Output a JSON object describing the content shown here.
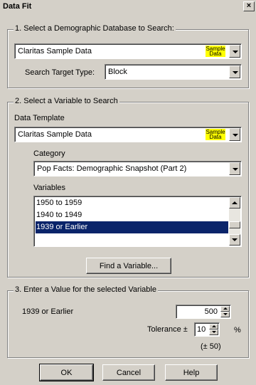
{
  "window": {
    "title": "Data Fit",
    "close_glyph": "×"
  },
  "section1": {
    "title": "1. Select a Demographic Database to Search:",
    "database": {
      "value": "Claritas Sample Data",
      "badge_line1": "Sample",
      "badge_line2": "Data"
    },
    "target_type_label": "Search Target Type:",
    "target_type_value": "Block"
  },
  "section2": {
    "title": "2. Select a Variable to Search",
    "data_template_label": "Data Template",
    "data_template": {
      "value": "Claritas Sample Data",
      "badge_line1": "Sample",
      "badge_line2": "Data"
    },
    "category_label": "Category",
    "category_value": "Pop Facts: Demographic Snapshot (Part 2)",
    "variables_label": "Variables",
    "variables": [
      {
        "label": "1950 to 1959",
        "selected": false
      },
      {
        "label": "1940 to 1949",
        "selected": false
      },
      {
        "label": "1939 or Earlier",
        "selected": true
      }
    ],
    "find_button": "Find a Variable..."
  },
  "section3": {
    "title": "3. Enter a Value for the selected Variable",
    "variable_label": "1939 or Earlier",
    "value": "500",
    "tolerance_label": "Tolerance ±",
    "tolerance_value": "10",
    "percent": "%",
    "tolerance_note": "(± 50)"
  },
  "buttons": {
    "ok": "OK",
    "cancel": "Cancel",
    "help": "Help"
  },
  "colors": {
    "dialog_bg": "#d4d0c8",
    "selection": "#0a246a",
    "sample_badge": "#ffff00"
  }
}
